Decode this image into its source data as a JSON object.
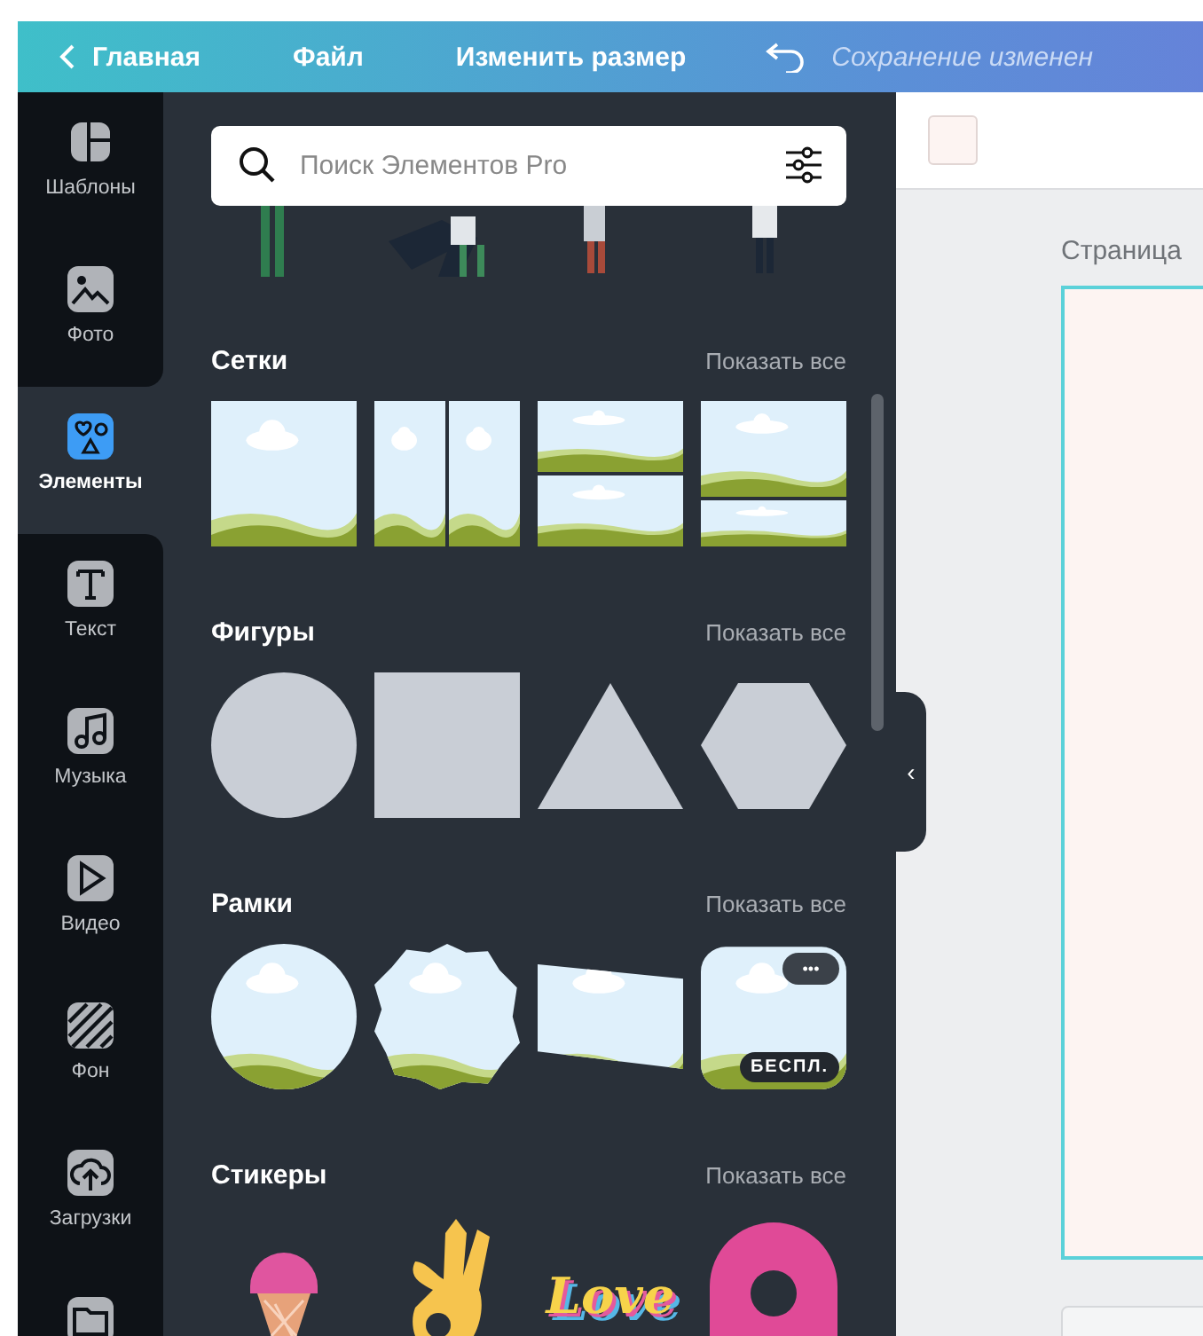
{
  "top_bar": {
    "back_label": "Главная",
    "menu": [
      {
        "label": "Файл"
      },
      {
        "label": "Изменить размер"
      }
    ],
    "status": "Сохранение изменен"
  },
  "sidebar": {
    "items": [
      {
        "kind": "templates",
        "label": "Шаблоны",
        "selected": false
      },
      {
        "label": "Фото",
        "selected": false
      },
      {
        "kind": "elements",
        "label": "Элементы",
        "selected": true
      },
      {
        "kind": "text",
        "label": "Текст",
        "selected": false
      },
      {
        "kind": "music",
        "label": "Музыка",
        "selected": false
      },
      {
        "kind": "video",
        "label": "Видео",
        "selected": false
      },
      {
        "kind": "background",
        "label": "Фон",
        "selected": false
      },
      {
        "kind": "uploads",
        "label": "Загрузки",
        "selected": false
      },
      {
        "kind": "folder",
        "selected": false
      }
    ]
  },
  "panel": {
    "search": {
      "placeholder": "Поиск Элементов Pro"
    },
    "sections": [
      {
        "kind": "grids",
        "title": "Сетки",
        "show_all": "Показать все",
        "items": [
          {
            "kind": "single"
          },
          {
            "kind": "columns"
          },
          {
            "kind": "rows"
          },
          {
            "kind": "rows_uneven"
          }
        ]
      },
      {
        "kind": "shapes",
        "title": "Фигуры",
        "show_all": "Показать все",
        "items": [
          {
            "kind": "circle"
          },
          {
            "kind": "square"
          },
          {
            "kind": "triangle"
          },
          {
            "kind": "hexagon"
          }
        ]
      },
      {
        "kind": "frames",
        "title": "Рамки",
        "show_all": "Показать все",
        "items": [
          {
            "kind": "circle"
          },
          {
            "kind": "scalloped"
          },
          {
            "kind": "skewed"
          },
          {
            "kind": "rounded",
            "menu": "•••",
            "badge": "БЕСПЛ."
          }
        ]
      },
      {
        "kind": "stickers",
        "title": "Стикеры",
        "show_all": "Показать все",
        "items": [
          {
            "kind": "icecream"
          },
          {
            "kind": "hand"
          },
          {
            "kind": "lettering",
            "text": "Love"
          },
          {
            "kind": "donut"
          }
        ]
      }
    ]
  },
  "collapse": {
    "label": "‹"
  },
  "canvas": {
    "page_label": "Страница"
  }
}
